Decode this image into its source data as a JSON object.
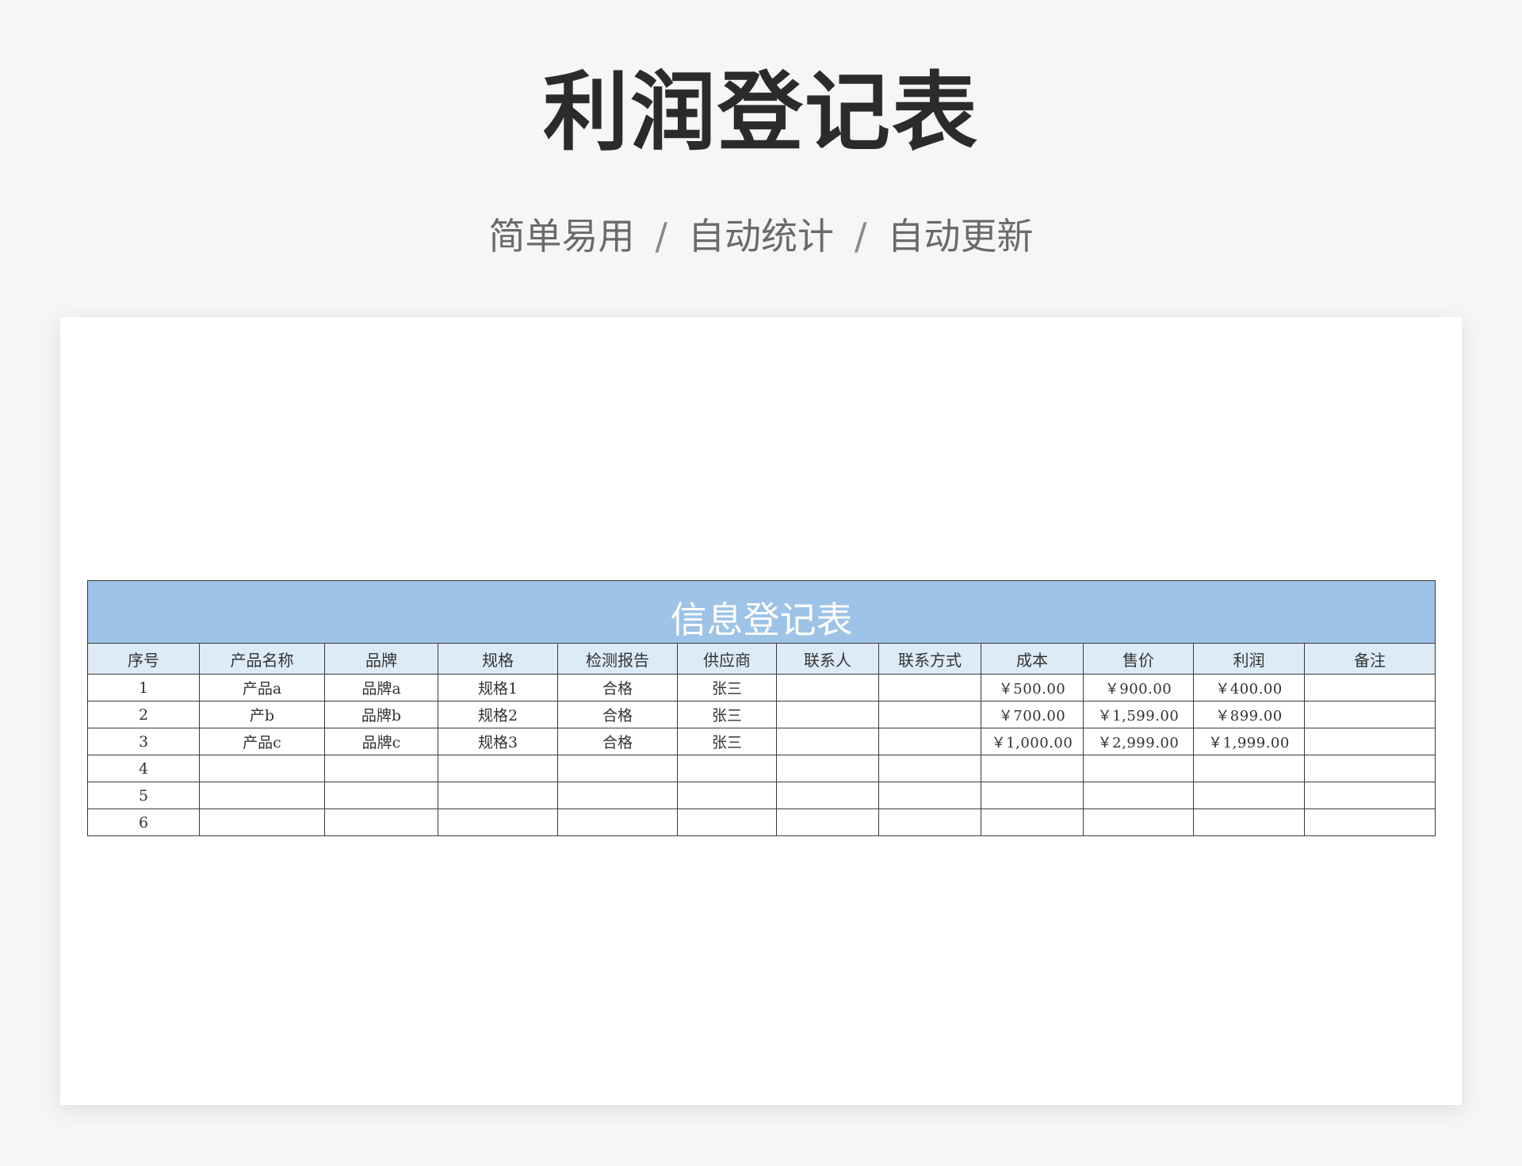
{
  "page": {
    "title": "利润登记表",
    "tagline": [
      "简单易用",
      "自动统计",
      "自动更新"
    ],
    "tagline_separator": "/"
  },
  "sheet": {
    "title": "信息登记表",
    "columns": [
      "序号",
      "产品名称",
      "品牌",
      "规格",
      "检测报告",
      "供应商",
      "联系人",
      "联系方式",
      "成本",
      "售价",
      "利润",
      "备注"
    ],
    "rows": [
      [
        "1",
        "产品a",
        "品牌a",
        "规格1",
        "合格",
        "张三",
        "",
        "",
        "￥500.00",
        "￥900.00",
        "￥400.00",
        ""
      ],
      [
        "2",
        "产b",
        "品牌b",
        "规格2",
        "合格",
        "张三",
        "",
        "",
        "￥700.00",
        "￥1,599.00",
        "￥899.00",
        ""
      ],
      [
        "3",
        "产品c",
        "品牌c",
        "规格3",
        "合格",
        "张三",
        "",
        "",
        "￥1,000.00",
        "￥2,999.00",
        "￥1,999.00",
        ""
      ],
      [
        "4",
        "",
        "",
        "",
        "",
        "",
        "",
        "",
        "",
        "",
        "",
        ""
      ],
      [
        "5",
        "",
        "",
        "",
        "",
        "",
        "",
        "",
        "",
        "",
        "",
        ""
      ],
      [
        "6",
        "",
        "",
        "",
        "",
        "",
        "",
        "",
        "",
        "",
        "",
        ""
      ]
    ]
  },
  "colors": {
    "title_bar": "#9dc3e6",
    "header_bg": "#ddebf7",
    "page_bg": "#f5f6f8"
  }
}
